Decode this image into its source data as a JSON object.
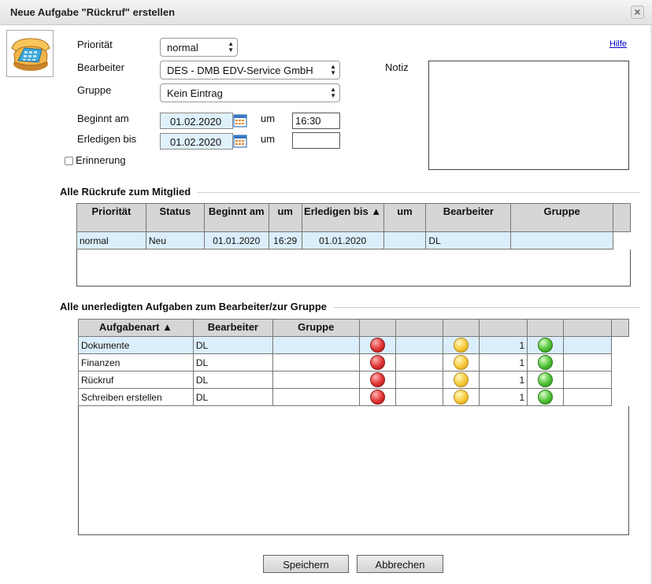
{
  "window": {
    "title": "Neue Aufgabe \"Rückruf\" erstellen",
    "close_label": "×"
  },
  "help": {
    "label": "Hilfe"
  },
  "form": {
    "prioritaet": {
      "label": "Priorität",
      "value": "normal"
    },
    "bearbeiter": {
      "label": "Bearbeiter",
      "value": "DES - DMB EDV-Service GmbH"
    },
    "gruppe": {
      "label": "Gruppe",
      "value": "Kein Eintrag"
    },
    "beginnt": {
      "label": "Beginnt am",
      "date": "01.02.2020",
      "um_label": "um",
      "time": "16:30"
    },
    "erledigen": {
      "label": "Erledigen bis",
      "date": "01.02.2020",
      "um_label": "um",
      "time": ""
    },
    "erinnerung": {
      "label": "Erinnerung",
      "checked": false
    },
    "notiz": {
      "label": "Notiz",
      "value": ""
    }
  },
  "rueckrufe": {
    "title": "Alle Rückrufe zum Mitglied",
    "columns": [
      "Priorität",
      "Status",
      "Beginnt am",
      "um",
      "Erledigen bis ▲",
      "um",
      "Bearbeiter",
      "Gruppe"
    ],
    "rows": [
      {
        "prioritaet": "normal",
        "status": "Neu",
        "beginnt": "01.01.2020",
        "um": "16:29",
        "erledigen": "01.01.2020",
        "um2": "",
        "bearbeiter": "DL",
        "gruppe": ""
      }
    ]
  },
  "aufgaben": {
    "title": "Alle unerledigten Aufgaben zum Bearbeiter/zur Gruppe",
    "columns": [
      "Aufgabenart ▲",
      "Bearbeiter",
      "Gruppe"
    ],
    "rows": [
      {
        "art": "Dokumente",
        "bearbeiter": "DL",
        "gruppe": "",
        "count": "1"
      },
      {
        "art": "Finanzen",
        "bearbeiter": "DL",
        "gruppe": "",
        "count": "1"
      },
      {
        "art": "Rückruf",
        "bearbeiter": "DL",
        "gruppe": "",
        "count": "1"
      },
      {
        "art": "Schreiben erstellen",
        "bearbeiter": "DL",
        "gruppe": "",
        "count": "1"
      }
    ],
    "status_colors": {
      "red": "#e03333",
      "yellow": "#f6c93a",
      "green": "#4fc034"
    }
  },
  "buttons": {
    "save": "Speichern",
    "cancel": "Abbrechen"
  },
  "icons": {
    "task_icon": "telephone-icon",
    "calendar_icon": "calendar-icon"
  }
}
